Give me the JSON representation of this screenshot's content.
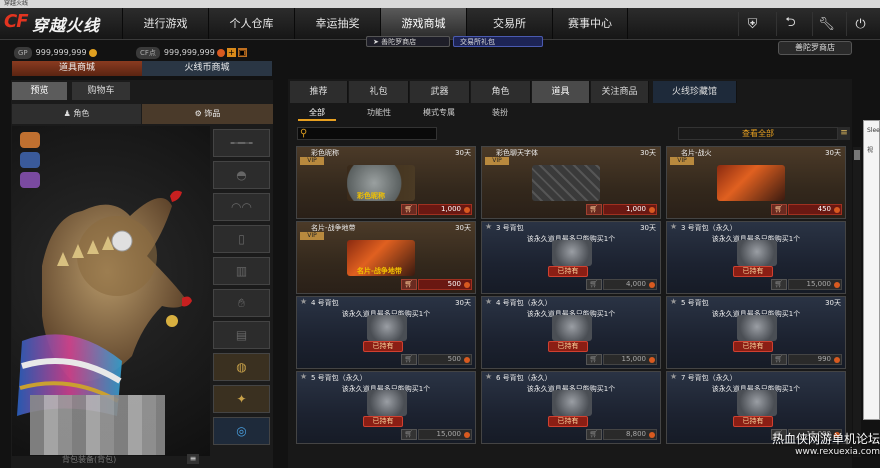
{
  "window_title": "穿越火线",
  "brand": {
    "mark": "CF",
    "title": "穿越火线"
  },
  "nav": {
    "tabs": [
      "进行游戏",
      "个人仓库",
      "幸运抽奖",
      "游戏商城",
      "交易所",
      "赛事中心"
    ],
    "active": "游戏商城",
    "icons": [
      "shield-icon",
      "back-icon",
      "wrench-icon",
      "power-icon"
    ],
    "sub": [
      "➤ 善陀罗商店",
      "交易所礼包"
    ]
  },
  "currency": {
    "gp_label": "GP",
    "gp_value": "999,999,999",
    "cf_label": "CF点",
    "cf_value": "999,999,999"
  },
  "about_button": "善陀罗商店",
  "shop_tabs": [
    "道具商城",
    "火线币商城"
  ],
  "left_tabs": [
    "预览",
    "购物车"
  ],
  "char_tabs": [
    "角色",
    "饰品"
  ],
  "left_bottom_text": "背包装备(背包)",
  "categories": [
    "推荐",
    "礼包",
    "武器",
    "角色",
    "道具",
    "关注商品",
    "火线珍藏馆"
  ],
  "active_category": "道具",
  "subcategories": [
    "全部",
    "功能性",
    "模式专属",
    "装扮"
  ],
  "search": {
    "placeholder": ""
  },
  "filter": "查看全部",
  "cards": [
    {
      "name": "彩色昵称",
      "days": "30天",
      "vip": "VIP",
      "price": "1,000",
      "style": "brown",
      "img": "tag",
      "img_label": "彩色昵称",
      "star": false
    },
    {
      "name": "彩色聊天字体",
      "days": "30天",
      "vip": "VIP",
      "price": "1,000",
      "style": "brown",
      "img": "keys",
      "star": false
    },
    {
      "name": "名片-战火",
      "days": "30天",
      "vip": "VIP",
      "price": "450",
      "style": "brown",
      "img": "fire",
      "star": false
    },
    {
      "name": "名片-战争地带",
      "days": "30天",
      "vip": "VIP",
      "price": "500",
      "style": "brown",
      "img": "fire",
      "img_label": "名片-战争地带",
      "star": false
    },
    {
      "name": "3 号背包",
      "days": "30天",
      "limit": "该永久道具最多只能购买1个",
      "owned": "已持有",
      "price": "4,000",
      "style": "blue",
      "img": "bag",
      "star": true
    },
    {
      "name": "3 号背包（永久）",
      "days": "",
      "limit": "该永久道具最多只能购买1个",
      "owned": "已持有",
      "price": "15,000",
      "style": "blue",
      "img": "bag",
      "star": true
    },
    {
      "name": "4 号背包",
      "days": "30天",
      "limit": "该永久道具最多只能购买1个",
      "owned": "已持有",
      "price": "500",
      "style": "blue",
      "img": "bag",
      "star": true
    },
    {
      "name": "4 号背包（永久）",
      "days": "",
      "limit": "该永久道具最多只能购买1个",
      "owned": "已持有",
      "price": "15,000",
      "style": "blue",
      "img": "bag",
      "star": true
    },
    {
      "name": "5 号背包",
      "days": "30天",
      "limit": "该永久道具最多只能购买1个",
      "owned": "已持有",
      "price": "990",
      "style": "blue",
      "img": "bag",
      "star": true
    },
    {
      "name": "5 号背包（永久）",
      "days": "",
      "limit": "该永久道具最多只能购买1个",
      "owned": "已持有",
      "price": "15,000",
      "style": "blue",
      "img": "bag",
      "star": true
    },
    {
      "name": "6 号背包（永久）",
      "days": "",
      "limit": "该永久道具最多只能购买1个",
      "owned": "已持有",
      "price": "8,800",
      "style": "blue",
      "img": "bag",
      "star": true
    },
    {
      "name": "7 号背包（永久）",
      "days": "",
      "limit": "该永久道具最多只能购买1个",
      "owned": "已持有",
      "price": "15,000",
      "style": "blue",
      "img": "bag",
      "star": true
    }
  ],
  "popup_text": [
    "Slee",
    "视"
  ],
  "watermark": {
    "title": "热血侠网游单机论坛",
    "url": "www.rexuexia.com"
  },
  "colors": {
    "accent": "#e8a020",
    "price_red": "#6a1812",
    "brand_red": "#e23420"
  }
}
